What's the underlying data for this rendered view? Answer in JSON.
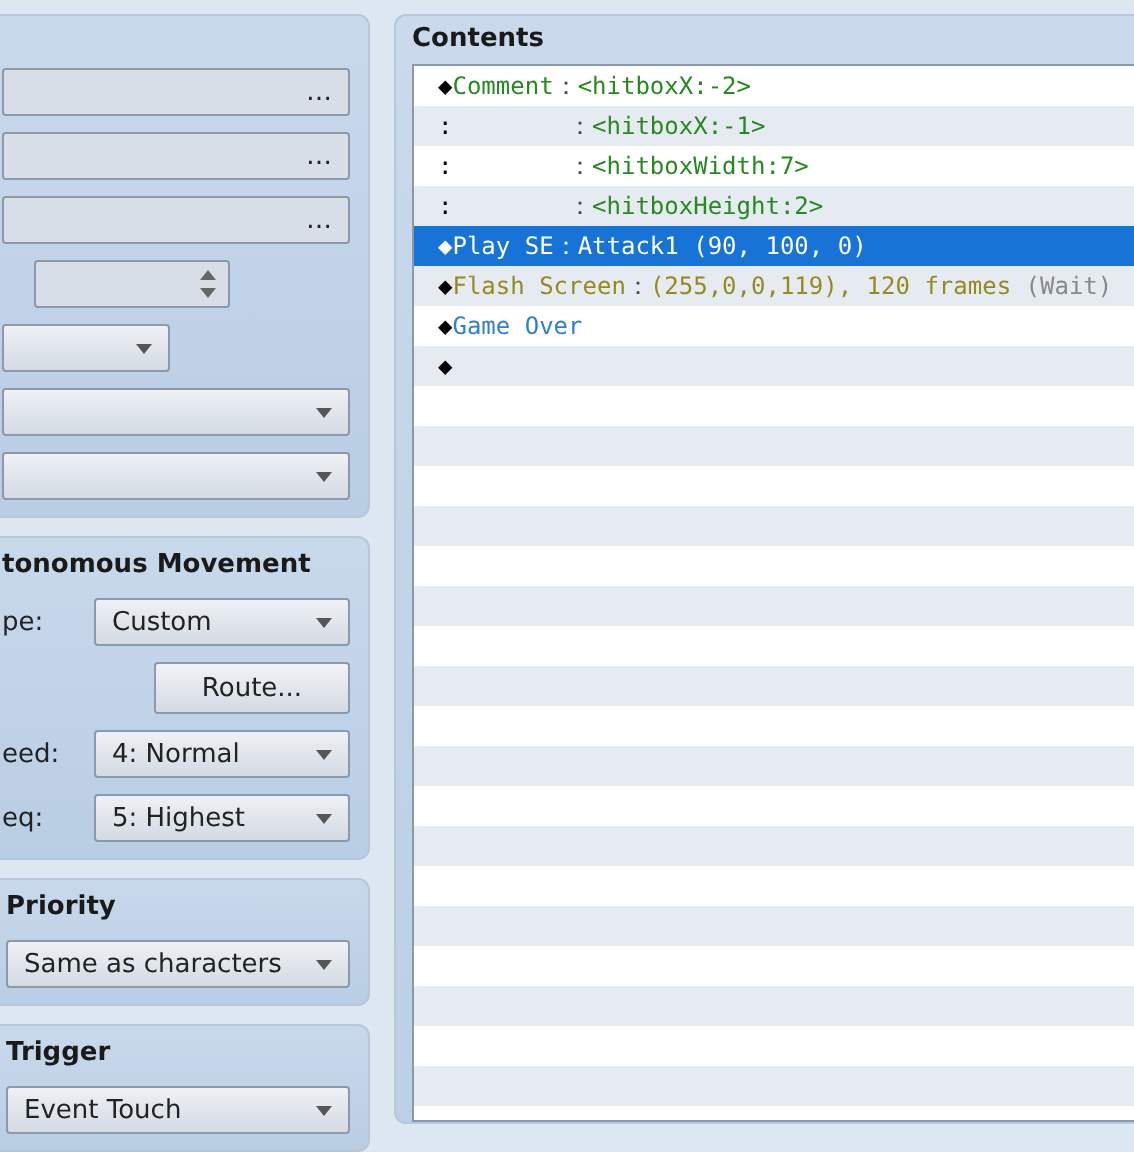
{
  "general": {
    "browse_buttons": [
      "…",
      "…",
      "…"
    ]
  },
  "autonomous_movement": {
    "title": "tonomous Movement",
    "type": {
      "label": "pe:",
      "value": "Custom"
    },
    "route_button": "Route...",
    "speed": {
      "label": "eed:",
      "value": "4: Normal"
    },
    "frequency": {
      "label": "eq:",
      "value": "5: Highest"
    }
  },
  "priority": {
    "title": "Priority",
    "value": "Same as characters"
  },
  "trigger": {
    "title": "Trigger",
    "value": "Event Touch"
  },
  "contents": {
    "title": "Contents",
    "rows": [
      {
        "kind": "comment",
        "selected": false,
        "marker": "◆",
        "command": "Comment",
        "separator": "：",
        "params": "<hitboxX:-2>"
      },
      {
        "kind": "comment-cont",
        "selected": false,
        "marker": ":",
        "command": "",
        "separator": "：",
        "params": "<hitboxX:-1>"
      },
      {
        "kind": "comment-cont",
        "selected": false,
        "marker": ":",
        "command": "",
        "separator": "：",
        "params": "<hitboxWidth:7>"
      },
      {
        "kind": "comment-cont",
        "selected": false,
        "marker": ":",
        "command": "",
        "separator": "：",
        "params": "<hitboxHeight:2>"
      },
      {
        "kind": "audio",
        "selected": true,
        "marker": "◆",
        "command": "Play SE",
        "separator": "：",
        "params": "Attack1 (90, 100, 0)"
      },
      {
        "kind": "screen",
        "selected": false,
        "marker": "◆",
        "command": "Flash Screen",
        "separator": "：",
        "params": "(255,0,0,119), 120 frames",
        "note": "(Wait)"
      },
      {
        "kind": "scene",
        "selected": false,
        "marker": "◆",
        "command": "Game Over"
      },
      {
        "kind": "empty",
        "selected": false,
        "marker": "◆"
      }
    ]
  }
}
